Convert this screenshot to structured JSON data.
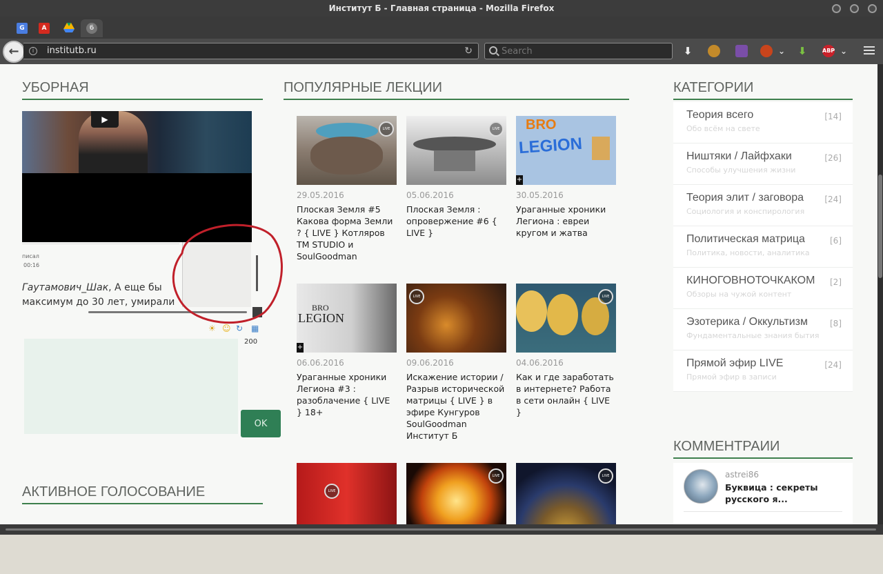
{
  "window": {
    "title": "Институт Б - Главная страница - Mozilla Firefox"
  },
  "browser": {
    "tabs": [
      {
        "icon": "google-translate-icon"
      },
      {
        "icon": "adobe-reader-icon"
      },
      {
        "icon": "google-drive-icon"
      },
      {
        "icon": "institut-b-favicon",
        "active": true
      }
    ],
    "new_tab": "+",
    "url": "institutb.ru",
    "search_placeholder": "Search",
    "toolbar_icons": [
      "download-icon",
      "extension-icon",
      "extension-icon",
      "extension-icon",
      "download-green-icon",
      "adblock-icon",
      "hamburger-menu-icon"
    ],
    "abp_label": "ABP"
  },
  "chat": {
    "section_title": "УБОРНАЯ",
    "meta_line1": "писал",
    "meta_line2": "00:16",
    "message_user": "Гаутамович_Шак",
    "message_text": ", А еще бы максимум до 30 лет, умирали",
    "char_count": "200",
    "ok_label": "OK"
  },
  "voting": {
    "section_title": "АКТИВНОЕ ГОЛОСОВАНИЕ"
  },
  "lectures": {
    "section_title": "ПОПУЛЯРНЫЕ ЛЕКЦИИ",
    "items": [
      {
        "date": "29.05.2016",
        "title": "Плоская Земля #5 Какова форма Земли ? { LIVE } Котляров TM STUDIO и SoulGoodman"
      },
      {
        "date": "05.06.2016",
        "title": "Плоская Земля : опровержение #6 { LIVE }"
      },
      {
        "date": "30.05.2016",
        "title": "Ураганные хроники Легиона : евреи кругом и жатва"
      },
      {
        "date": "06.06.2016",
        "title": "Ураганные хроники Легиона #3 : разоблачение { LIVE } 18+"
      },
      {
        "date": "09.06.2016",
        "title": "Искажение истории / Разрыв исторической матрицы { LIVE } в эфире Кунгуров SoulGoodman Институт Б"
      },
      {
        "date": "04.06.2016",
        "title": "Как и где заработать в интернете? Работа в сети онлайн { LIVE }"
      }
    ],
    "thumb_texts": {
      "bro": "BRO",
      "legion": "LEGION",
      "live": "LIVE",
      "plus": "+"
    }
  },
  "categories": {
    "section_title": "КАТЕГОРИИ",
    "items": [
      {
        "name": "Теория всего",
        "count": "[14]",
        "desc": "Обо всём на свете"
      },
      {
        "name": "Ништяки / Лайфхаки",
        "count": "[26]",
        "desc": "Способы улучшения жизни"
      },
      {
        "name": "Теория элит / заговора",
        "count": "[24]",
        "desc": "Социология и конспирология"
      },
      {
        "name": "Политическая матрица",
        "count": "[6]",
        "desc": "Политика, новости, аналитика"
      },
      {
        "name": "КИНОГОВНОТОЧКАКОМ",
        "count": "[2]",
        "desc": "Обзоры на чужой контент"
      },
      {
        "name": "Эзотерика / Оккультизм",
        "count": "[8]",
        "desc": "Фундаментальные знания бытия"
      },
      {
        "name": "Прямой эфир LIVE",
        "count": "[24]",
        "desc": "Прямой эфир в записи"
      }
    ]
  },
  "comments": {
    "section_title": "КОММЕНТРАИИ",
    "user": "astrei86",
    "text": "Буквица : секреты русского я..."
  },
  "colors": {
    "accent": "#3d7f4c",
    "ok_button": "#2f7f55",
    "annotation": "#c0202a"
  }
}
